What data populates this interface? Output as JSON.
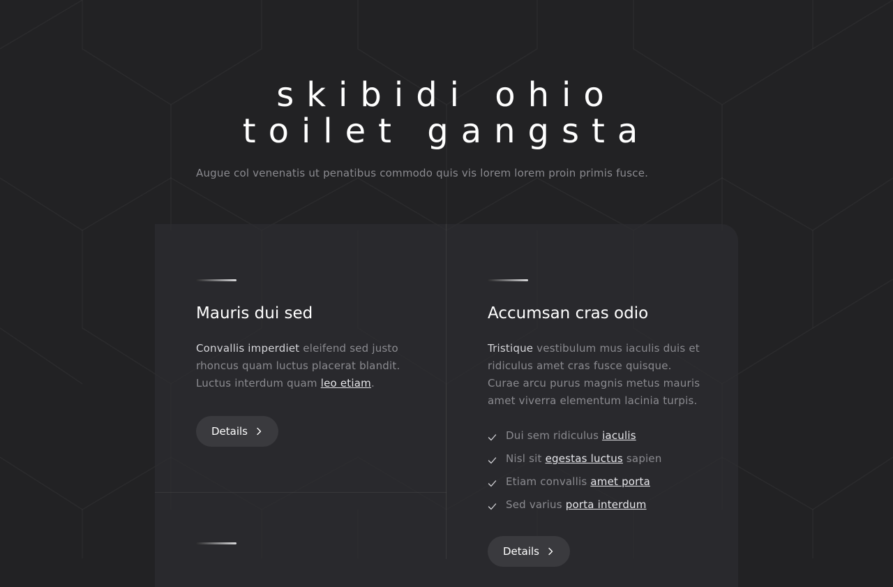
{
  "hero": {
    "title_line1": "skibidi ohio",
    "title_line2": "toilet gangsta",
    "subtitle": "Augue col venenatis ut penatibus commodo quis vis lorem lorem proin primis fusce."
  },
  "cards": [
    {
      "title": "Mauris dui sed",
      "text_strong": "Convallis imperdiet",
      "text_body": " eleifend sed justo rhoncus quam luctus placerat blandit. Luctus interdum quam ",
      "text_link": "leo etiam",
      "text_end": ".",
      "button_label": "Details"
    },
    {
      "title": "Accumsan cras odio",
      "text_strong": "Tristique",
      "text_body": " vestibulum mus iaculis duis et ridiculus amet cras fusce quisque. Curae arcu purus magnis metus mauris amet viverra elementum lacinia turpis.",
      "list": [
        {
          "before": "Dui sem ridiculus ",
          "link": "iaculis",
          "after": ""
        },
        {
          "before": "Nisl sit ",
          "link": "egestas luctus",
          "after": " sapien"
        },
        {
          "before": "Etiam convallis ",
          "link": "amet porta",
          "after": ""
        },
        {
          "before": "Sed varius ",
          "link": "porta interdum",
          "after": ""
        }
      ],
      "button_label": "Details"
    }
  ],
  "icons": {
    "button_chevron": "chevron-right-icon",
    "list_check": "check-icon"
  },
  "colors": {
    "background": "#222224",
    "panel": "#2c2c30",
    "button": "#3a3a3e",
    "muted_text": "#8b8b90"
  }
}
